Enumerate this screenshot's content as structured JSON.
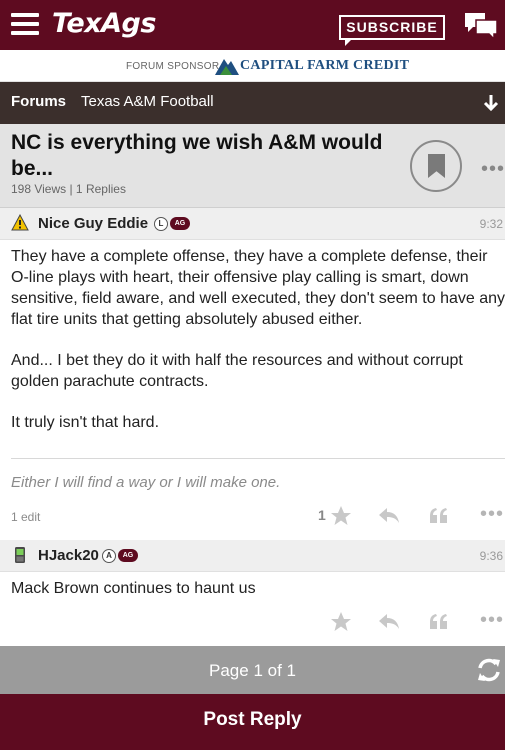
{
  "header": {
    "logo": "TexAgs",
    "subscribe_label": "SUBSCRIBE",
    "menu_icon": "hamburger-icon",
    "chat_icon": "chat-bubbles-icon"
  },
  "sponsor": {
    "label": "FORUM SPONSOR",
    "name": "CAPITAL FARM CREDIT"
  },
  "nav": {
    "forums": "Forums",
    "board": "Texas A&M Football",
    "jump_icon": "arrow-down-icon"
  },
  "thread": {
    "title": "NC is everything we wish A&M would be...",
    "stats": "198 Views | 1 Replies",
    "bookmark_icon": "bookmark-icon",
    "more": "•••"
  },
  "posts": [
    {
      "user": "Nice Guy Eddie",
      "user_icon": "warning-icon",
      "badges": [
        "L",
        "AG"
      ],
      "time": "9:32",
      "body": [
        "They have a complete offense, they have a complete defense, their O-line plays with heart, their offensive play calling is smart, down sensitive, field aware, and well executed, they don't seem to have any flat tire units that getting absolutely abused either.",
        "And... I bet they do it with half the resources and without corrupt golden parachute contracts.",
        "It truly isn't that hard."
      ],
      "signature": "Either I will find a way or I will make one.",
      "edits": "1 edit",
      "stars": "1"
    },
    {
      "user": "HJack20",
      "user_icon": "phone-icon",
      "badges": [
        "A",
        "AG"
      ],
      "time": "9:36",
      "body": [
        "Mack Brown continues to haunt us"
      ]
    }
  ],
  "footer": {
    "page_label": "Page 1 of 1",
    "refresh_icon": "refresh-icon",
    "post_reply": "Post Reply"
  },
  "colors": {
    "brand": "#5e0b20",
    "nav_bg": "#3b2f2c",
    "header_bg": "#e3e3e3",
    "footer_bg": "#9b9b9b"
  }
}
